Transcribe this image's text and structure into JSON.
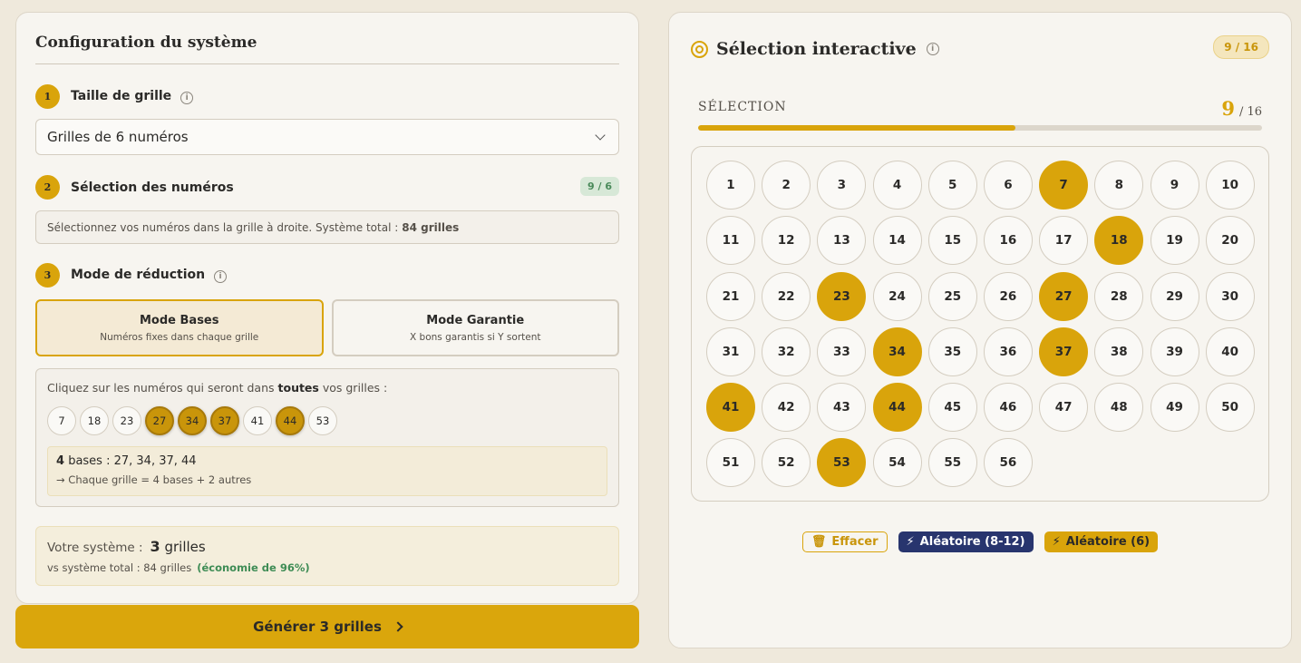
{
  "config": {
    "title": "Configuration du système",
    "steps": [
      {
        "num": "1",
        "label": "Taille de grille"
      },
      {
        "num": "2",
        "label": "Sélection des numéros"
      },
      {
        "num": "3",
        "label": "Mode de réduction"
      }
    ],
    "grid_select": "Grilles de 6 numéros",
    "selection_badge": "9 / 6",
    "hint_text": "Sélectionnez vos numéros dans la grille à droite. Système total :",
    "hint_bold": "84 grilles",
    "modes": [
      {
        "title": "Mode Bases",
        "sub": "Numéros fixes dans chaque grille",
        "active": true
      },
      {
        "title": "Mode Garantie",
        "sub": "X bons garantis si Y sortent",
        "active": false
      }
    ],
    "bases_instruction_pre": "Cliquez sur les numéros qui seront dans",
    "bases_instruction_bold": "toutes",
    "bases_instruction_post": "vos grilles :",
    "chips": [
      {
        "n": "7",
        "on": false
      },
      {
        "n": "18",
        "on": false
      },
      {
        "n": "23",
        "on": false
      },
      {
        "n": "27",
        "on": true
      },
      {
        "n": "34",
        "on": true
      },
      {
        "n": "37",
        "on": true
      },
      {
        "n": "41",
        "on": false
      },
      {
        "n": "44",
        "on": true
      },
      {
        "n": "53",
        "on": false
      }
    ],
    "bases_count": "4",
    "bases_text": "bases : 27, 34, 37, 44",
    "bases_rule": "→ Chaque grille = 4 bases + 2 autres",
    "system_label": "Votre système :",
    "system_count": "3",
    "system_unit": "grilles",
    "system_compare": "vs système total : 84 grilles",
    "system_saving": "(économie de 96%)",
    "generate_label": "Générer 3 grilles"
  },
  "selection": {
    "title": "Sélection interactive",
    "badge": "9 / 16",
    "label": "SÉLECTION",
    "count": "9",
    "max": "/ 16",
    "progress": 0.5625,
    "numbers": [
      {
        "n": "1",
        "on": false
      },
      {
        "n": "2",
        "on": false
      },
      {
        "n": "3",
        "on": false
      },
      {
        "n": "4",
        "on": false
      },
      {
        "n": "5",
        "on": false
      },
      {
        "n": "6",
        "on": false
      },
      {
        "n": "7",
        "on": true
      },
      {
        "n": "8",
        "on": false
      },
      {
        "n": "9",
        "on": false
      },
      {
        "n": "10",
        "on": false
      },
      {
        "n": "11",
        "on": false
      },
      {
        "n": "12",
        "on": false
      },
      {
        "n": "13",
        "on": false
      },
      {
        "n": "14",
        "on": false
      },
      {
        "n": "15",
        "on": false
      },
      {
        "n": "16",
        "on": false
      },
      {
        "n": "17",
        "on": false
      },
      {
        "n": "18",
        "on": true
      },
      {
        "n": "19",
        "on": false
      },
      {
        "n": "20",
        "on": false
      },
      {
        "n": "21",
        "on": false
      },
      {
        "n": "22",
        "on": false
      },
      {
        "n": "23",
        "on": true
      },
      {
        "n": "24",
        "on": false
      },
      {
        "n": "25",
        "on": false
      },
      {
        "n": "26",
        "on": false
      },
      {
        "n": "27",
        "on": true
      },
      {
        "n": "28",
        "on": false
      },
      {
        "n": "29",
        "on": false
      },
      {
        "n": "30",
        "on": false
      },
      {
        "n": "31",
        "on": false
      },
      {
        "n": "32",
        "on": false
      },
      {
        "n": "33",
        "on": false
      },
      {
        "n": "34",
        "on": true
      },
      {
        "n": "35",
        "on": false
      },
      {
        "n": "36",
        "on": false
      },
      {
        "n": "37",
        "on": true
      },
      {
        "n": "38",
        "on": false
      },
      {
        "n": "39",
        "on": false
      },
      {
        "n": "40",
        "on": false
      },
      {
        "n": "41",
        "on": true
      },
      {
        "n": "42",
        "on": false
      },
      {
        "n": "43",
        "on": false
      },
      {
        "n": "44",
        "on": true
      },
      {
        "n": "45",
        "on": false
      },
      {
        "n": "46",
        "on": false
      },
      {
        "n": "47",
        "on": false
      },
      {
        "n": "48",
        "on": false
      },
      {
        "n": "49",
        "on": false
      },
      {
        "n": "50",
        "on": false
      },
      {
        "n": "51",
        "on": false
      },
      {
        "n": "52",
        "on": false
      },
      {
        "n": "53",
        "on": true
      },
      {
        "n": "54",
        "on": false
      },
      {
        "n": "55",
        "on": false
      },
      {
        "n": "56",
        "on": false
      }
    ],
    "actions": {
      "clear": "Effacer",
      "random_range": "Aléatoire (8-12)",
      "random_six": "Aléatoire (6)"
    }
  },
  "colors": {
    "accent": "#d9a40b",
    "navy": "#28356e",
    "background": "#efe9dc",
    "card": "#f7f5f0",
    "success": "#3e8c55"
  }
}
